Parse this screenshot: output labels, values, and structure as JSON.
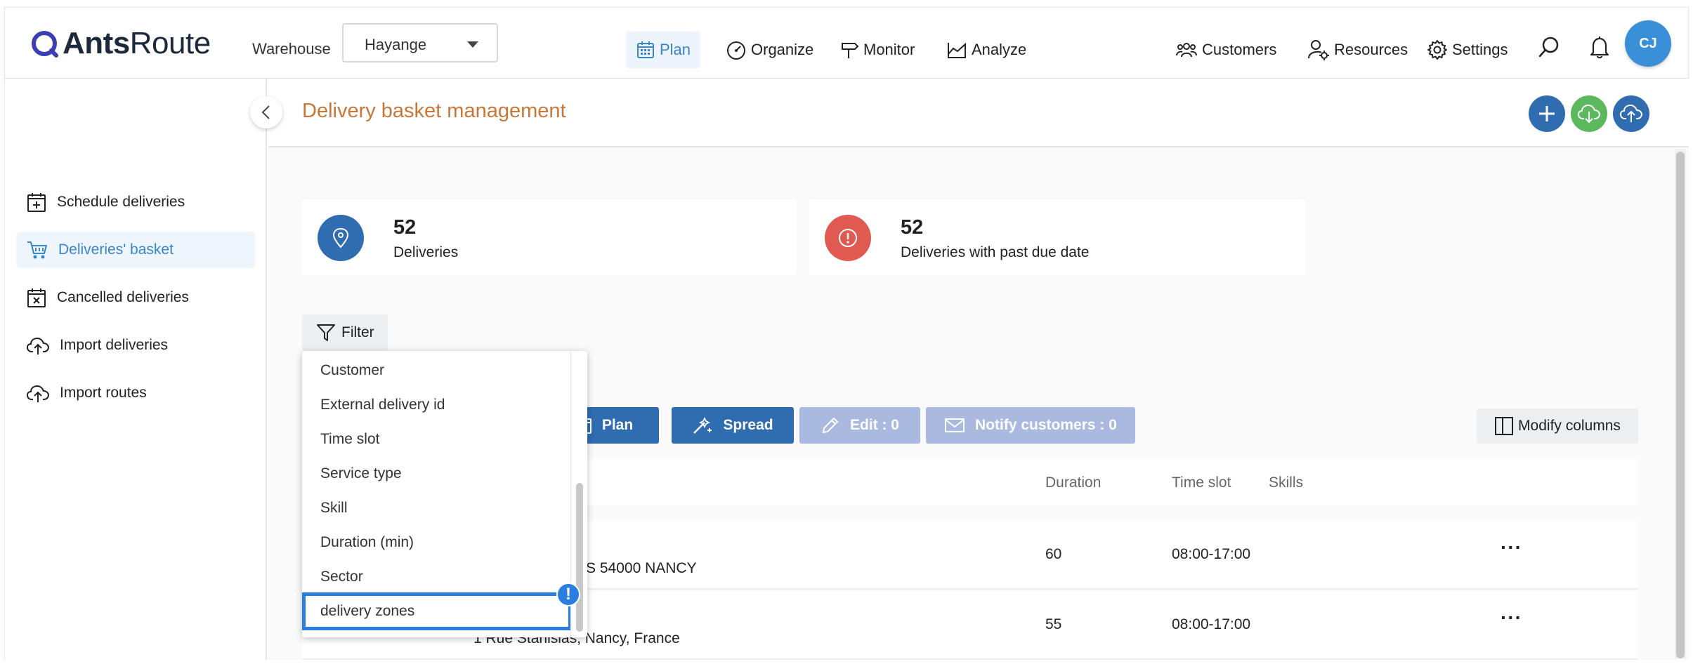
{
  "header": {
    "logo_text_bold": "Ants",
    "logo_text_light": "Route",
    "warehouse_label": "Warehouse",
    "warehouse_value": "Hayange",
    "nav": [
      {
        "label": "Plan",
        "icon": "calendar-grid-icon",
        "active": true
      },
      {
        "label": "Organize",
        "icon": "gauge-icon"
      },
      {
        "label": "Monitor",
        "icon": "signpost-icon"
      },
      {
        "label": "Analyze",
        "icon": "chart-area-icon"
      }
    ],
    "right_nav": [
      {
        "label": "Customers",
        "icon": "users-icon"
      },
      {
        "label": "Resources",
        "icon": "user-gear-icon"
      },
      {
        "label": "Settings",
        "icon": "gear-icon"
      }
    ],
    "avatar_initials": "CJ",
    "colors": {
      "active": "#3a85c7",
      "avatar": "#3a8fd9"
    }
  },
  "sidebar": {
    "items": [
      {
        "label": "Schedule deliveries",
        "icon": "calendar-plus-icon"
      },
      {
        "label": "Deliveries' basket",
        "icon": "basket-icon",
        "active": true
      },
      {
        "label": "Cancelled deliveries",
        "icon": "calendar-x-icon"
      },
      {
        "label": "Import deliveries",
        "icon": "cloud-upload-icon"
      },
      {
        "label": "Import routes",
        "icon": "cloud-upload-icon"
      }
    ]
  },
  "main": {
    "title": "Delivery basket management",
    "title_color": "#c8773a",
    "stats": [
      {
        "value": "52",
        "label": "Deliveries",
        "color": "#2f6cb0"
      },
      {
        "value": "52",
        "label": "Deliveries with past due date",
        "color": "#e05a52"
      }
    ],
    "filter_label": "Filter",
    "actions": {
      "plan": "Plan",
      "spread": "Spread",
      "edit": "Edit : 0",
      "notify": "Notify customers : 0",
      "modify_columns": "Modify columns"
    },
    "table": {
      "columns": [
        "Duration",
        "Time slot",
        "Skills"
      ],
      "rows": [
        {
          "address": "AS 54000 NANCY",
          "duration": "60",
          "time_slot": "08:00-17:00"
        },
        {
          "address": "1 Rue Stanislas, Nancy, France",
          "duration": "55",
          "time_slot": "08:00-17:00"
        }
      ]
    }
  },
  "filter_dropdown": {
    "options": [
      "Customer",
      "External delivery id",
      "Time slot",
      "Service type",
      "Skill",
      "Duration (min)",
      "Sector",
      "delivery zones"
    ],
    "highlighted": "delivery zones",
    "badge": "!"
  }
}
